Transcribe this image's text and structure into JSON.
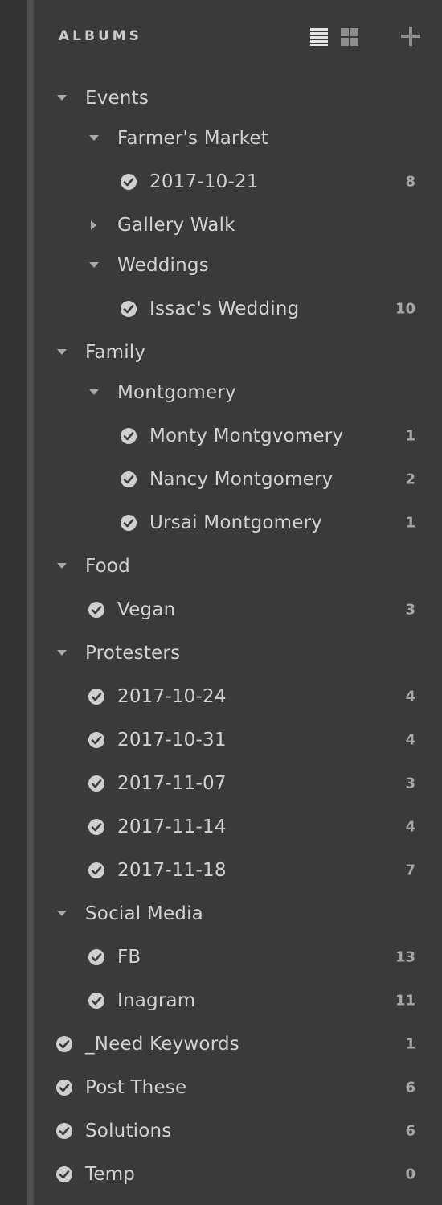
{
  "panel": {
    "title": "ALBUMS",
    "icons": {
      "list_view": "list-view-icon",
      "grid_view": "grid-view-icon",
      "add": "plus-icon"
    },
    "colors": {
      "background": "#3a3a3a",
      "text": "#d2d2d2",
      "count": "#a6a6a6",
      "check_circle": "#cfcfcf"
    }
  },
  "rows": [
    {
      "type": "folder",
      "label": "Events",
      "expanded": true,
      "level": 0
    },
    {
      "type": "folder",
      "label": "Farmer's Market",
      "expanded": true,
      "level": 1
    },
    {
      "type": "album",
      "label": "2017-10-21",
      "count": "8",
      "level": 2
    },
    {
      "type": "folder",
      "label": "Gallery Walk",
      "expanded": false,
      "level": 1
    },
    {
      "type": "folder",
      "label": "Weddings",
      "expanded": true,
      "level": 1
    },
    {
      "type": "album",
      "label": "Issac's Wedding",
      "count": "10",
      "level": 2
    },
    {
      "type": "folder",
      "label": "Family",
      "expanded": true,
      "level": 0
    },
    {
      "type": "folder",
      "label": "Montgomery",
      "expanded": true,
      "level": 1
    },
    {
      "type": "album",
      "label": "Monty Montgvomery",
      "count": "1",
      "level": 2
    },
    {
      "type": "album",
      "label": "Nancy Montgomery",
      "count": "2",
      "level": 2
    },
    {
      "type": "album",
      "label": "Ursai Montgomery",
      "count": "1",
      "level": 2
    },
    {
      "type": "folder",
      "label": "Food",
      "expanded": true,
      "level": 0
    },
    {
      "type": "album",
      "label": "Vegan",
      "count": "3",
      "level": 1
    },
    {
      "type": "folder",
      "label": "Protesters",
      "expanded": true,
      "level": 0
    },
    {
      "type": "album",
      "label": "2017-10-24",
      "count": "4",
      "level": 1
    },
    {
      "type": "album",
      "label": "2017-10-31",
      "count": "4",
      "level": 1
    },
    {
      "type": "album",
      "label": "2017-11-07",
      "count": "3",
      "level": 1
    },
    {
      "type": "album",
      "label": "2017-11-14",
      "count": "4",
      "level": 1
    },
    {
      "type": "album",
      "label": "2017-11-18",
      "count": "7",
      "level": 1
    },
    {
      "type": "folder",
      "label": "Social Media",
      "expanded": true,
      "level": 0
    },
    {
      "type": "album",
      "label": "FB",
      "count": "13",
      "level": 1
    },
    {
      "type": "album",
      "label": "Inagram",
      "count": "11",
      "level": 1
    },
    {
      "type": "album",
      "label": "_Need  Keywords",
      "count": "1",
      "level": 0
    },
    {
      "type": "album",
      "label": "Post These",
      "count": "6",
      "level": 0
    },
    {
      "type": "album",
      "label": "Solutions",
      "count": "6",
      "level": 0
    },
    {
      "type": "album",
      "label": "Temp",
      "count": "0",
      "level": 0
    }
  ]
}
